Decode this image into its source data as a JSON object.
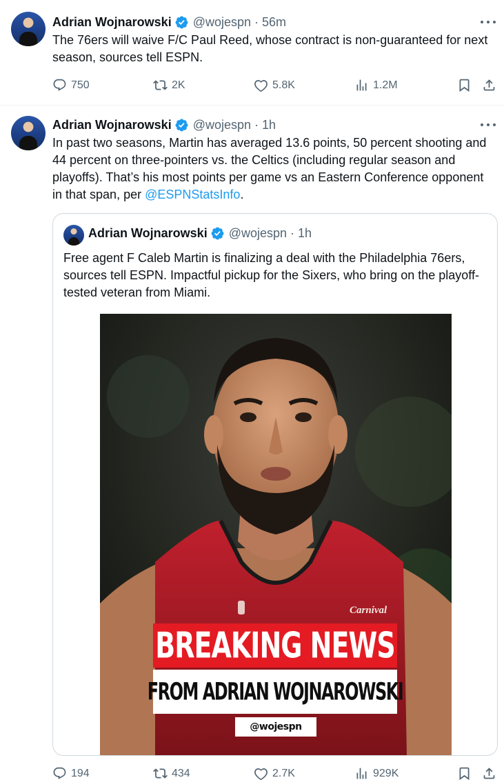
{
  "tweets": [
    {
      "author_name": "Adrian Wojnarowski",
      "handle": "@wojespn",
      "separator": "·",
      "time": "56m",
      "text": "The 76ers will waive F/C Paul Reed, whose contract is non-guaranteed for next season, sources tell ESPN.",
      "replies": "750",
      "reposts": "2K",
      "likes": "5.8K",
      "views": "1.2M"
    },
    {
      "author_name": "Adrian Wojnarowski",
      "handle": "@wojespn",
      "separator": "·",
      "time": "1h",
      "text": "In past two seasons, Martin has averaged 13.6 points, 50 percent shooting and 44 percent on three-pointers vs. the Celtics (including regular season and playoffs). That’s his most points per game vs an Eastern Conference opponent in that span, per ",
      "mention": "@ESPNStatsInfo",
      "text_end": ".",
      "replies": "194",
      "reposts": "434",
      "likes": "2.7K",
      "views": "929K",
      "quote": {
        "author_name": "Adrian Wojnarowski",
        "handle": "@wojespn",
        "separator": "·",
        "time": "1h",
        "text": "Free agent F Caleb Martin is finalizing a deal with the Philadelphia 76ers, sources tell ESPN. Impactful pickup for the Sixers, who bring on the playoff-tested veteran from Miami.",
        "image": {
          "headline": "BREAKING NEWS",
          "subheadline": "FROM ADRIAN WOJNAROWSKI",
          "tag": "@wojespn",
          "jersey_logo": "Carnival"
        }
      }
    }
  ],
  "colors": {
    "text": "#0f1419",
    "secondary": "#536471",
    "link": "#1d9bf0",
    "verified": "#1d9bf0",
    "banner_red": "#e41b23",
    "jersey_red": "#b01e2a"
  },
  "icons": [
    "verified-badge-icon",
    "more-icon",
    "reply-icon",
    "repost-icon",
    "like-icon",
    "views-icon",
    "bookmark-icon",
    "share-icon"
  ]
}
